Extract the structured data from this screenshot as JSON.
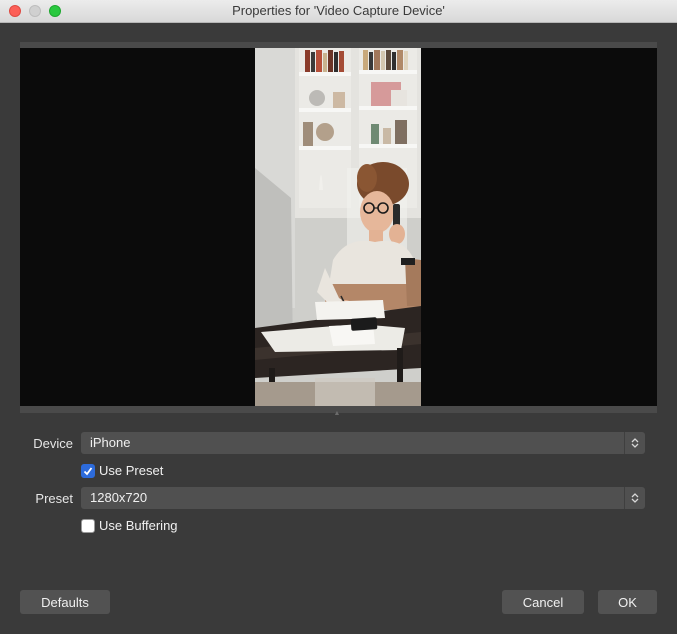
{
  "window": {
    "title": "Properties for 'Video Capture Device'"
  },
  "form": {
    "device_label": "Device",
    "device_value": "iPhone",
    "use_preset_label": "Use Preset",
    "use_preset_checked": true,
    "preset_label": "Preset",
    "preset_value": "1280x720",
    "use_buffering_label": "Use Buffering",
    "use_buffering_checked": false
  },
  "buttons": {
    "defaults": "Defaults",
    "cancel": "Cancel",
    "ok": "OK"
  },
  "icons": {
    "close": "close-icon",
    "minimize": "minimize-icon",
    "maximize": "maximize-icon",
    "combo_arrows": "chevron-up-down-icon",
    "checkmark": "checkmark-icon"
  },
  "colors": {
    "accent": "#2d6bdb",
    "window_bg": "#3a3a3a",
    "control_bg": "#505050",
    "preview_bg": "#0b0b0b"
  }
}
